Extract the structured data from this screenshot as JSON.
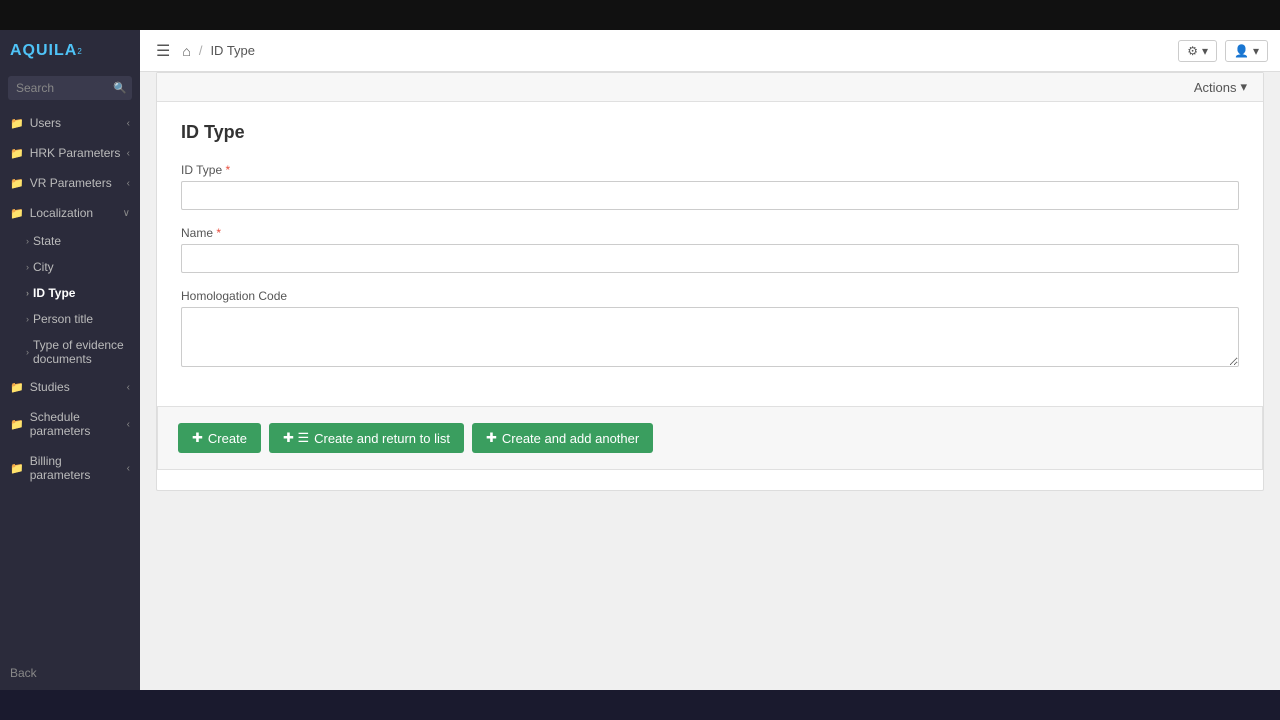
{
  "app": {
    "logo": "AQUILA",
    "logo_sup": "2"
  },
  "header": {
    "menu_icon": "☰",
    "home_icon": "⌂",
    "breadcrumb_sep": "/",
    "breadcrumb_current": "ID Type",
    "settings_label": "⚙",
    "user_label": "👤"
  },
  "actions": {
    "label": "Actions",
    "dropdown_icon": "▾"
  },
  "search": {
    "placeholder": "Search",
    "icon": "🔍"
  },
  "sidebar": {
    "items": [
      {
        "id": "users",
        "label": "Users",
        "icon": "📁",
        "has_arrow": true
      },
      {
        "id": "hrk-parameters",
        "label": "HRK Parameters",
        "icon": "📁",
        "has_arrow": true
      },
      {
        "id": "vr-parameters",
        "label": "VR Parameters",
        "icon": "📁",
        "has_arrow": true
      },
      {
        "id": "localization",
        "label": "Localization",
        "icon": "📁",
        "has_arrow": true,
        "expanded": true
      },
      {
        "id": "studies",
        "label": "Studies",
        "icon": "📁",
        "has_arrow": true
      },
      {
        "id": "schedule-parameters",
        "label": "Schedule parameters",
        "icon": "📁",
        "has_arrow": true
      },
      {
        "id": "billing-parameters",
        "label": "Billing parameters",
        "icon": "📁",
        "has_arrow": true
      }
    ],
    "localization_subitems": [
      {
        "id": "state",
        "label": "State",
        "active": false
      },
      {
        "id": "city",
        "label": "City",
        "active": false
      },
      {
        "id": "id-type",
        "label": "ID Type",
        "active": true
      },
      {
        "id": "person-title",
        "label": "Person title",
        "active": false
      },
      {
        "id": "type-evidence-documents",
        "label": "Type of evidence documents",
        "active": false
      }
    ],
    "back_label": "Back"
  },
  "form": {
    "title": "ID Type",
    "fields": [
      {
        "id": "id-type",
        "label": "ID Type",
        "required": true,
        "type": "text",
        "value": ""
      },
      {
        "id": "name",
        "label": "Name",
        "required": true,
        "type": "text",
        "value": ""
      },
      {
        "id": "homologation-code",
        "label": "Homologation Code",
        "required": false,
        "type": "textarea",
        "value": ""
      }
    ],
    "buttons": {
      "create": "Create",
      "create_return": "Create and return to list",
      "create_another": "Create and add another"
    },
    "create_icon": "✚",
    "list_icon": "☰",
    "plus_icon": "✚"
  }
}
